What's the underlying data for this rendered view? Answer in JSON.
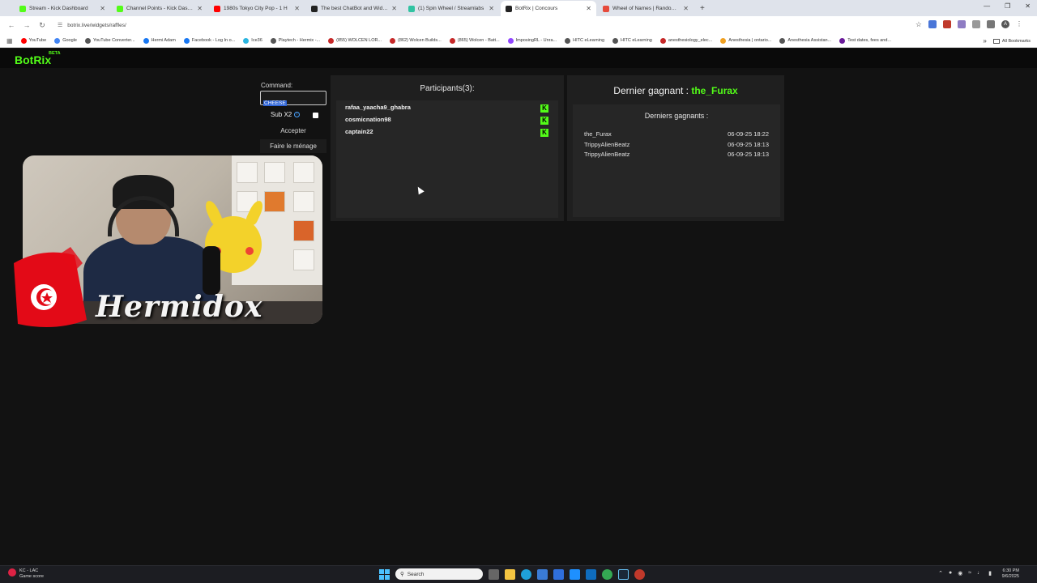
{
  "browser": {
    "tabs": [
      {
        "title": "Stream - Kick Dashboard",
        "color": "#53fc18",
        "active": false
      },
      {
        "title": "Channel Points - Kick Dashboard",
        "color": "#53fc18",
        "active": false
      },
      {
        "title": "1980s Tokyo City Pop - 1 H",
        "color": "#ff0000",
        "active": false
      },
      {
        "title": "The best ChatBot and Widgets",
        "color": "#222222",
        "active": false
      },
      {
        "title": "(1) Spin Wheel / Streamlabs",
        "color": "#31c3a2",
        "active": false
      },
      {
        "title": "BotRix | Concours",
        "color": "#222222",
        "active": true
      },
      {
        "title": "Wheel of Names | Random na",
        "color": "#e64a3b",
        "active": false
      }
    ],
    "new_tab": "+",
    "url": "botrix.live/widgets/raffles/",
    "bookmarks": [
      {
        "label": "YouTube",
        "color": "#ff0000"
      },
      {
        "label": "Google",
        "color": "#4285f4"
      },
      {
        "label": "YouTube Converter...",
        "color": "#555555"
      },
      {
        "label": "Hermi Adam",
        "color": "#1877f2"
      },
      {
        "label": "Facebook - Log In o...",
        "color": "#1877f2"
      },
      {
        "label": "Ice36",
        "color": "#2bb5e0"
      },
      {
        "label": "Playtech - Hermix -...",
        "color": "#555555"
      },
      {
        "label": "(855) WOLCEN LOR...",
        "color": "#c62828"
      },
      {
        "label": "(862) Wolcen Builds...",
        "color": "#c62828"
      },
      {
        "label": "(865) Wolcen - Batt...",
        "color": "#c62828"
      },
      {
        "label": "ImposingRL - Unra...",
        "color": "#9146ff"
      },
      {
        "label": "HITC eLearning",
        "color": "#555555"
      },
      {
        "label": "HITC eLearning",
        "color": "#555555"
      },
      {
        "label": "anesthesiology_elec...",
        "color": "#c62828"
      },
      {
        "label": "Anesthesia | ontario...",
        "color": "#f0a020"
      },
      {
        "label": "Anesthesia Assistan...",
        "color": "#555555"
      },
      {
        "label": "Test dates, fees and...",
        "color": "#6a1b9a"
      }
    ],
    "all_bookmarks": "All Bookmarks",
    "profile_initial": "A"
  },
  "app": {
    "logo": "BotRix",
    "beta": "BETA",
    "accent": "#53fc18"
  },
  "controls": {
    "command_label": "Command:",
    "command_value": "CHEESE",
    "sub_label": "Sub X2",
    "sub_checked": false,
    "accept_label": "Accepter",
    "clean_label": "Faire le ménage"
  },
  "participants": {
    "title": "Participants(3):",
    "items": [
      {
        "name": "rafaa_yaacha9_ghabra"
      },
      {
        "name": "cosmicnation98"
      },
      {
        "name": "captain22"
      }
    ],
    "platform_icon": "K"
  },
  "winners": {
    "title_prefix": "Dernier gagnant :",
    "last_winner": "the_Furax",
    "list_title": "Derniers gagnants :",
    "items": [
      {
        "name": "the_Furax",
        "date": "06-09-25 18:22"
      },
      {
        "name": "TrippyAlienBeatz",
        "date": "06-09-25 18:13"
      },
      {
        "name": "TrippyAlienBeatz",
        "date": "06-09-25 18:13"
      }
    ]
  },
  "overlay": {
    "streamer_name": "Hermidox"
  },
  "taskbar": {
    "weather_title": "KC - LAC",
    "weather_sub": "Game score",
    "search_placeholder": "Search",
    "time": "6:30 PM",
    "date": "9/6/2025"
  }
}
